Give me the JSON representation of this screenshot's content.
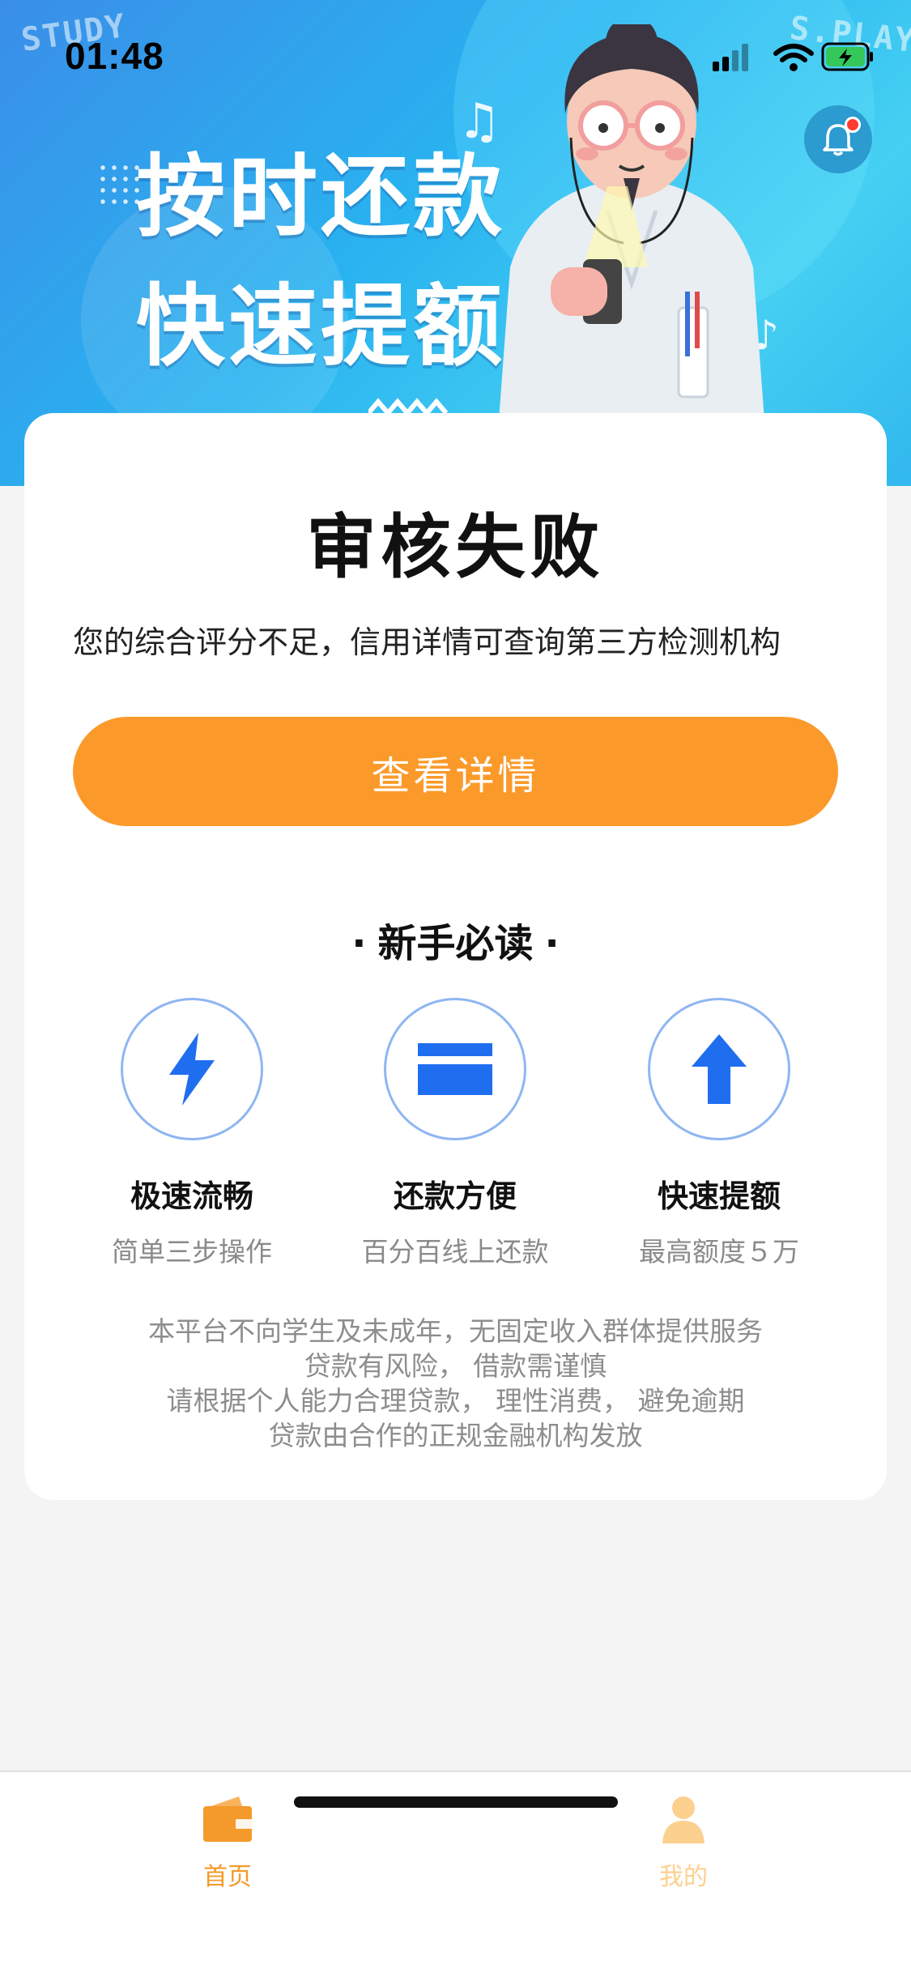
{
  "status_bar": {
    "time": "01:48"
  },
  "banner": {
    "slogan_line1": "按时还款",
    "slogan_line2": "快速提额",
    "deco_left": "STUDY",
    "deco_right": "S.PLAY"
  },
  "result": {
    "title": "审核失败",
    "description": "您的综合评分不足，信用详情可查询第三方检测机构",
    "button_label": "查看详情"
  },
  "guide": {
    "title": "新手必读",
    "bullet": "·",
    "features": [
      {
        "icon": "lightning-icon",
        "title": "极速流畅",
        "subtitle": "简单三步操作"
      },
      {
        "icon": "card-icon",
        "title": "还款方便",
        "subtitle": "百分百线上还款"
      },
      {
        "icon": "arrow-up-icon",
        "title": "快速提额",
        "subtitle": "最高额度５万"
      }
    ]
  },
  "disclaimer": [
    "本平台不向学生及未成年，无固定收入群体提供服务",
    "贷款有风险， 借款需谨慎",
    "请根据个人能力合理贷款， 理性消费， 避免逾期",
    "贷款由合作的正规金融机构发放"
  ],
  "tabbar": {
    "tabs": [
      {
        "label": "首页",
        "icon": "wallet-icon",
        "active": true
      },
      {
        "label": "我的",
        "icon": "user-icon",
        "active": false
      }
    ]
  },
  "colors": {
    "accent": "#fb9a2a",
    "feature_blue": "#1f6ef0",
    "circle_border": "#8fb6f2"
  }
}
